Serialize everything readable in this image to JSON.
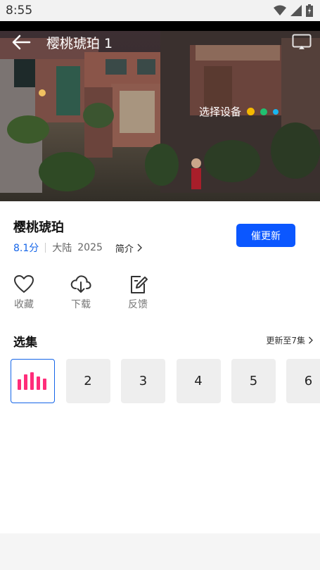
{
  "status_bar": {
    "time": "8:55"
  },
  "player": {
    "title": "樱桃琥珀 1",
    "cast_device_label": "选择设备",
    "device_dot_colors": [
      "#f5b800",
      "#20c070",
      "#18b6f0"
    ]
  },
  "show": {
    "title": "樱桃琥珀",
    "score": "8.1分",
    "region": "大陆",
    "year": "2025",
    "intro_label": "简介",
    "urge_button": "催更新"
  },
  "actions": [
    {
      "label": "收藏",
      "icon": "heart-icon"
    },
    {
      "label": "下载",
      "icon": "download-icon"
    },
    {
      "label": "反馈",
      "icon": "feedback-icon"
    }
  ],
  "episodes": {
    "section_title": "选集",
    "update_text": "更新至7集",
    "current_icon": "playing-bars-icon",
    "accent_color": "#ff2d7a",
    "items": [
      "2",
      "3",
      "4",
      "5",
      "6"
    ]
  }
}
